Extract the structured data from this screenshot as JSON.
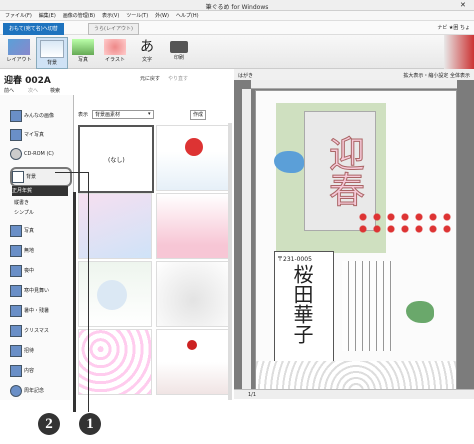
{
  "window": {
    "title": "筆ぐるめ for Windows"
  },
  "menu": [
    "ファイル(F)",
    "編集(E)",
    "画像の管理(B)",
    "表示(V)",
    "ツール(T)",
    "外(W)",
    "ヘルプ(H)"
  ],
  "tabs": [
    {
      "label": "おもて(宛て名)へ切替"
    },
    {
      "label": "うら(レイアウト)"
    }
  ],
  "header_right": "ナビ ★困 ちょ",
  "ribbon": [
    {
      "label": "レイアウト"
    },
    {
      "label": "背景"
    },
    {
      "label": "写真"
    },
    {
      "label": "イラスト"
    },
    {
      "label": "文字"
    },
    {
      "label": "印刷"
    }
  ],
  "doc": {
    "title": "迎春 002A",
    "b1": "元に戻す",
    "b2": "やり直す",
    "link1": "前へ",
    "link2": "次へ",
    "link3": "検索"
  },
  "filter": {
    "label": "表示",
    "value": "背景画素材",
    "right": "作成"
  },
  "sidebar": {
    "items": [
      {
        "label": "みんなの画像"
      },
      {
        "label": "マイ写真"
      },
      {
        "label": "CD-ROM (C)"
      },
      {
        "label": "背景"
      },
      {
        "label": "正月年賀"
      },
      {
        "label": "縦書き"
      },
      {
        "label": "シンプル"
      },
      {
        "label": "写真"
      },
      {
        "label": "無地"
      },
      {
        "label": "喪中"
      },
      {
        "label": "寒中見舞い"
      },
      {
        "label": "暑中・残暑"
      },
      {
        "label": "クリスマス"
      },
      {
        "label": "招待"
      },
      {
        "label": "内容"
      },
      {
        "label": "周年記念"
      }
    ]
  },
  "grid": {
    "none_label": "(なし)"
  },
  "preview": {
    "label": "はがき",
    "right": "拡大表示・縮小設定 全体表示",
    "kanji": "迎春",
    "name": "桜田華子",
    "zip": "〒231-0005",
    "page": "1/1"
  },
  "callouts": [
    {
      "label": "2"
    },
    {
      "label": "1"
    }
  ]
}
